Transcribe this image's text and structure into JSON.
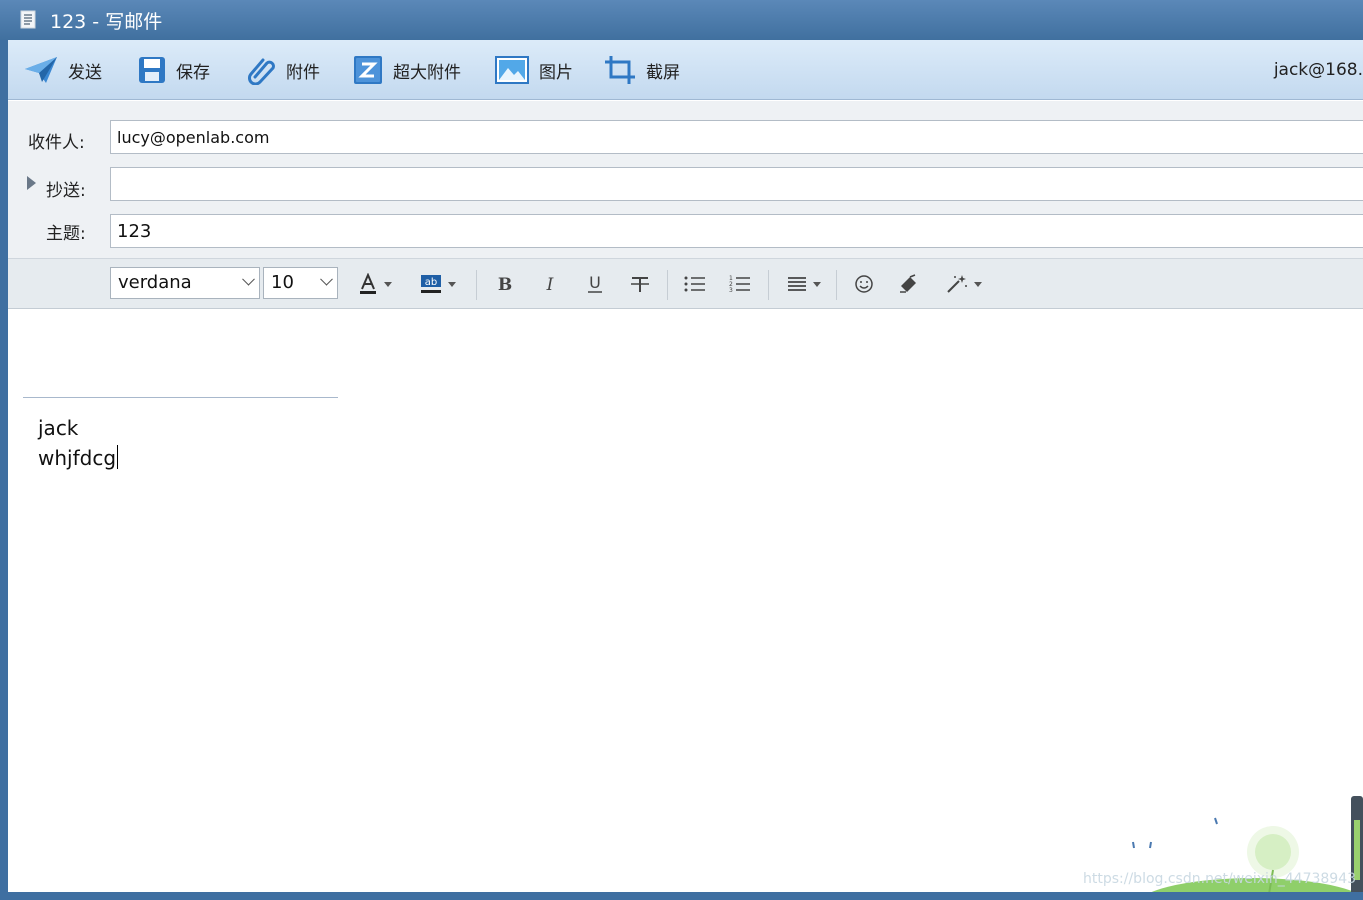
{
  "window": {
    "title": "123 - 写邮件"
  },
  "toolbar": {
    "send": "发送",
    "save": "保存",
    "attach": "附件",
    "large_attach": "超大附件",
    "image": "图片",
    "screenshot": "截屏",
    "account": "jack@168."
  },
  "headers": {
    "to_label": "收件人:",
    "to_value": "lucy@openlab.com",
    "cc_label": "抄送:",
    "cc_value": "",
    "subject_label": "主题:",
    "subject_value": "123"
  },
  "format": {
    "font": "verdana",
    "size": "10"
  },
  "editor": {
    "signature_name": "jack",
    "body_text": "whjfdcg"
  },
  "watermark": "https://blog.csdn.net/weixin_44738943",
  "colors": {
    "titlebar": "#40709f",
    "toolbar": "#c3d9ef",
    "icon_blue": "#2f78c4"
  }
}
